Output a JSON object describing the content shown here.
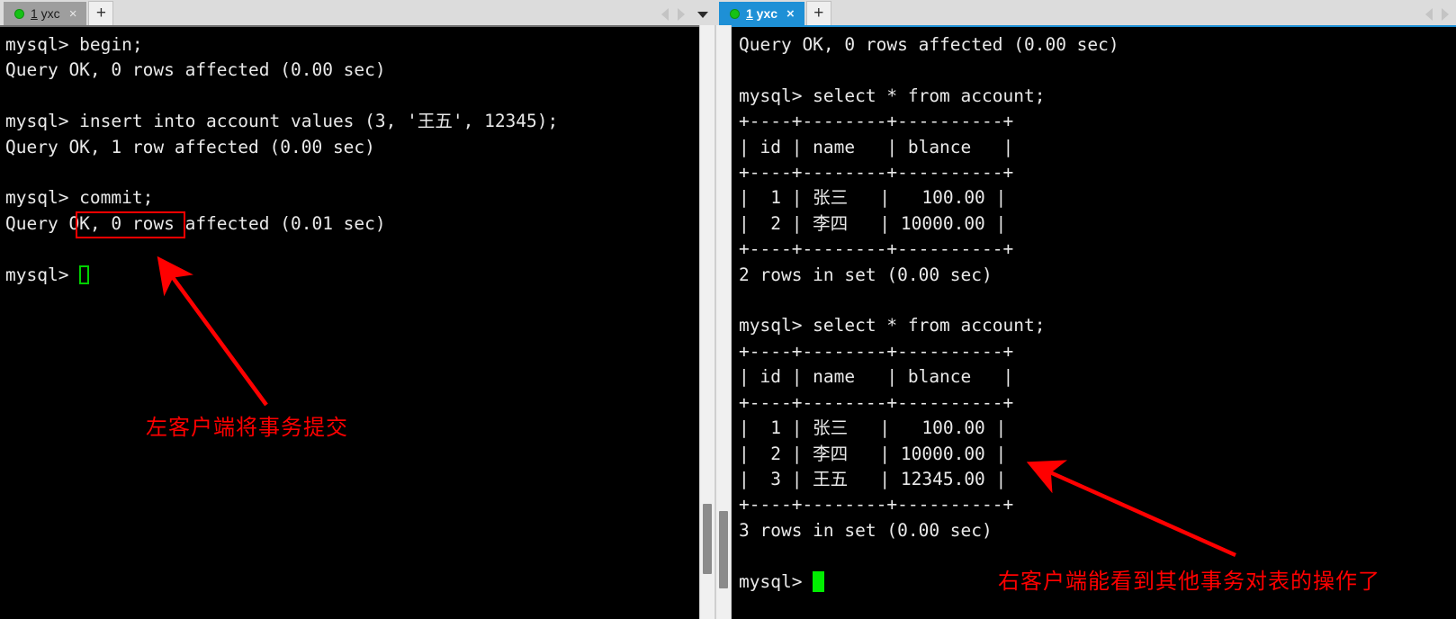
{
  "left_window": {
    "tab": {
      "dot": "status-dot-green",
      "number": "1",
      "label": " yxc",
      "close": "×",
      "state": "inactive"
    },
    "new_tab_label": "+",
    "terminal_text": "mysql> begin;\nQuery OK, 0 rows affected (0.00 sec)\n\nmysql> insert into account values (3, '王五', 12345);\nQuery OK, 1 row affected (0.00 sec)\n\nmysql> commit;\nQuery OK, 0 rows affected (0.01 sec)\n\nmysql> ",
    "lines": [
      "mysql> begin;",
      "Query OK, 0 rows affected (0.00 sec)",
      "",
      "mysql> insert into account values (3, '王五', 12345);",
      "Query OK, 1 row affected (0.00 sec)",
      "",
      "mysql> commit;",
      "Query OK, 0 rows affected (0.01 sec)",
      "",
      "mysql> "
    ],
    "highlighted_command": "commit;",
    "annotation": "左客户端将事务提交",
    "cursor": "hollow-green-block"
  },
  "right_window": {
    "tab": {
      "dot": "status-dot-green",
      "number": "1",
      "label": " yxc",
      "close": "×",
      "state": "active"
    },
    "new_tab_label": "+",
    "terminal_text": "Query OK, 0 rows affected (0.00 sec)\n\nmysql> select * from account;\n+----+--------+----------+\n| id | name   | blance   |\n+----+--------+----------+\n|  1 | 张三   |   100.00 |\n|  2 | 李四   | 10000.00 |\n+----+--------+----------+\n2 rows in set (0.00 sec)\n\nmysql> select * from account;\n+----+--------+----------+\n| id | name   | blance   |\n+----+--------+----------+\n|  1 | 张三   |   100.00 |\n|  2 | 李四   | 10000.00 |\n|  3 | 王五   | 12345.00 |\n+----+--------+----------+\n3 rows in set (0.00 sec)\n\nmysql> ",
    "query": "select * from account;",
    "first_result": {
      "columns": [
        "id",
        "name",
        "blance"
      ],
      "rows": [
        [
          "1",
          "张三",
          "100.00"
        ],
        [
          "2",
          "李四",
          "10000.00"
        ]
      ],
      "footer": "2 rows in set (0.00 sec)"
    },
    "second_result": {
      "columns": [
        "id",
        "name",
        "blance"
      ],
      "rows": [
        [
          "1",
          "张三",
          "100.00"
        ],
        [
          "2",
          "李四",
          "10000.00"
        ],
        [
          "3",
          "王五",
          "12345.00"
        ]
      ],
      "footer": "3 rows in set (0.00 sec)"
    },
    "annotation": "右客户端能看到其他事务对表的操作了",
    "cursor": "solid-green-block"
  },
  "colors": {
    "annotation_red": "#ff0000",
    "terminal_bg": "#000000",
    "terminal_fg": "#e9e9e9",
    "active_tab": "#1e90d6",
    "inactive_tab": "#9e9e9e",
    "cursor_green": "#00ee00"
  }
}
